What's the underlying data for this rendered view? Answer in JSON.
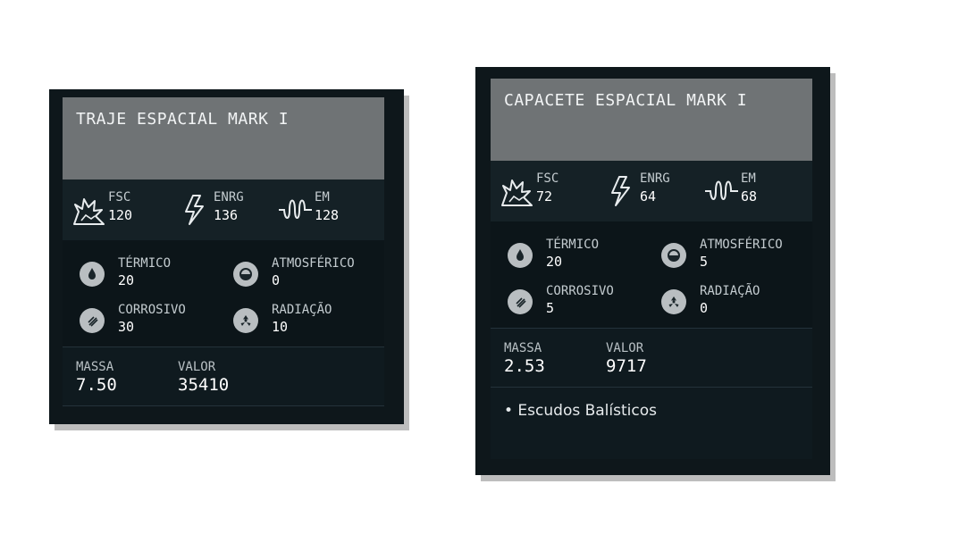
{
  "cards": [
    {
      "title": "TRAJE ESPACIAL MARK I",
      "damage": [
        {
          "label": "FSC",
          "value": "120",
          "icon": "explosion-icon"
        },
        {
          "label": "ENRG",
          "value": "136",
          "icon": "lightning-icon"
        },
        {
          "label": "EM",
          "value": "128",
          "icon": "wave-icon"
        }
      ],
      "resistances": [
        {
          "label": "TÉRMICO",
          "value": "20",
          "icon": "drop-icon"
        },
        {
          "label": "ATMOSFÉRICO",
          "value": "0",
          "icon": "atmosphere-icon"
        },
        {
          "label": "CORROSIVO",
          "value": "30",
          "icon": "corrosive-icon"
        },
        {
          "label": "RADIAÇÃO",
          "value": "10",
          "icon": "radiation-icon"
        }
      ],
      "mass_label": "MASSA",
      "mass": "7.50",
      "value_label": "VALOR",
      "value": "35410"
    },
    {
      "title": "CAPACETE ESPACIAL MARK I",
      "damage": [
        {
          "label": "FSC",
          "value": "72",
          "icon": "explosion-icon"
        },
        {
          "label": "ENRG",
          "value": "64",
          "icon": "lightning-icon"
        },
        {
          "label": "EM",
          "value": "68",
          "icon": "wave-icon"
        }
      ],
      "resistances": [
        {
          "label": "TÉRMICO",
          "value": "20",
          "icon": "drop-icon"
        },
        {
          "label": "ATMOSFÉRICO",
          "value": "5",
          "icon": "atmosphere-icon"
        },
        {
          "label": "CORROSIVO",
          "value": "5",
          "icon": "corrosive-icon"
        },
        {
          "label": "RADIAÇÃO",
          "value": "0",
          "icon": "radiation-icon"
        }
      ],
      "mass_label": "MASSA",
      "mass": "2.53",
      "value_label": "VALOR",
      "value": "9717",
      "perk": "• Escudos Balísticos"
    }
  ]
}
